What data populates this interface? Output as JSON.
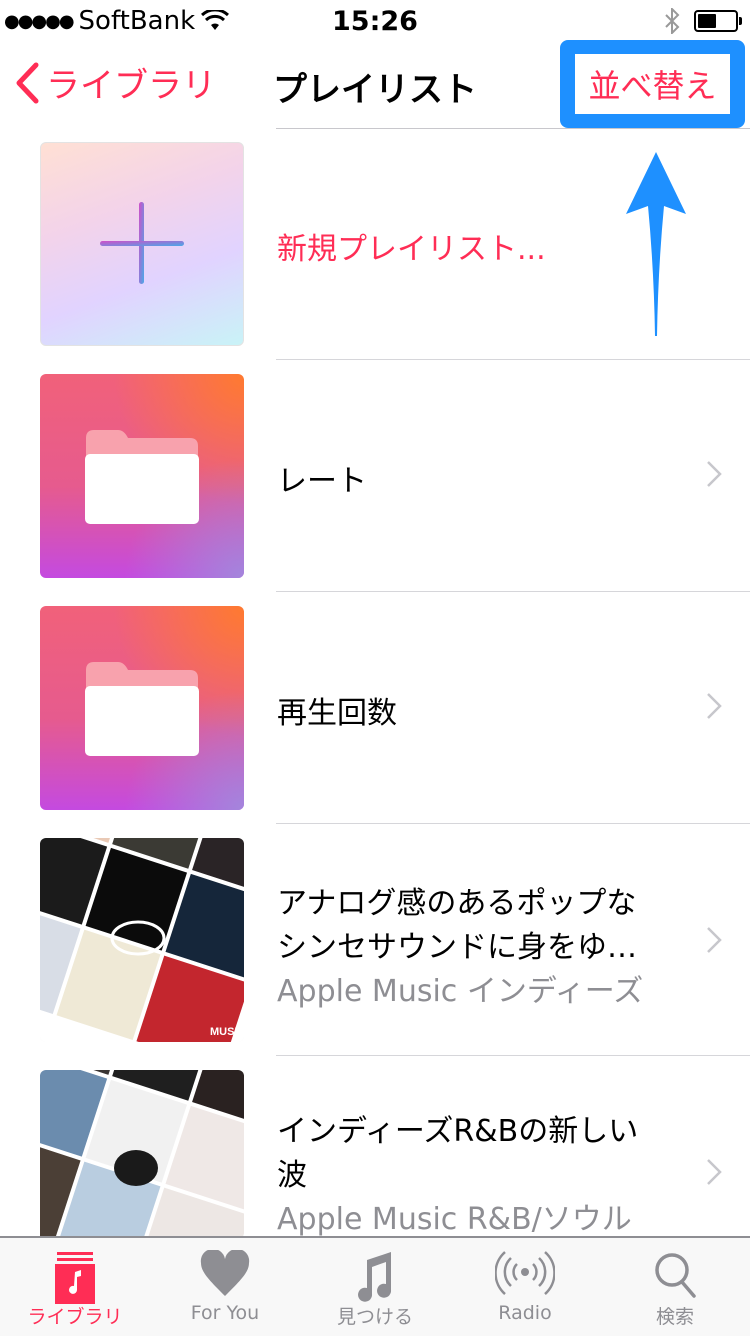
{
  "status_bar": {
    "signal_dots": "●●●●●",
    "carrier": "SoftBank",
    "wifi_icon": "wifi-icon",
    "time": "15:26",
    "bluetooth_icon": "bluetooth-icon",
    "battery_level_percent": 45
  },
  "nav": {
    "back_label": "ライブラリ",
    "title": "プレイリスト",
    "sort_label": "並べ替え",
    "highlight_color": "#1e90ff",
    "accent_color": "#ff2d55"
  },
  "playlists": [
    {
      "type": "new",
      "title": "新規プレイリスト...",
      "artwork": "plus-icon"
    },
    {
      "type": "folder",
      "title": "レート",
      "artwork": "folder-icon"
    },
    {
      "type": "folder",
      "title": "再生回数",
      "artwork": "folder-icon"
    },
    {
      "type": "playlist",
      "title_line1": "アナログ感のあるポップな",
      "title_line2": "シンセサウンドに身をゆ…",
      "subtitle": "Apple Music インディーズ",
      "artwork": "album-mosaic",
      "artwork_badge": " MUSIC"
    },
    {
      "type": "playlist",
      "title_line1": "インディーズR&Bの新しい",
      "title_line2": "波",
      "subtitle": "Apple Music R&B/ソウル",
      "artwork": "album-mosaic"
    }
  ],
  "tabbar": {
    "tabs": [
      {
        "label": "ライブラリ",
        "icon": "library-icon",
        "active": true
      },
      {
        "label": "For You",
        "icon": "heart-icon",
        "active": false
      },
      {
        "label": "見つける",
        "icon": "music-note-icon",
        "active": false
      },
      {
        "label": "Radio",
        "icon": "radio-icon",
        "active": false
      },
      {
        "label": "検索",
        "icon": "search-icon",
        "active": false
      }
    ]
  }
}
